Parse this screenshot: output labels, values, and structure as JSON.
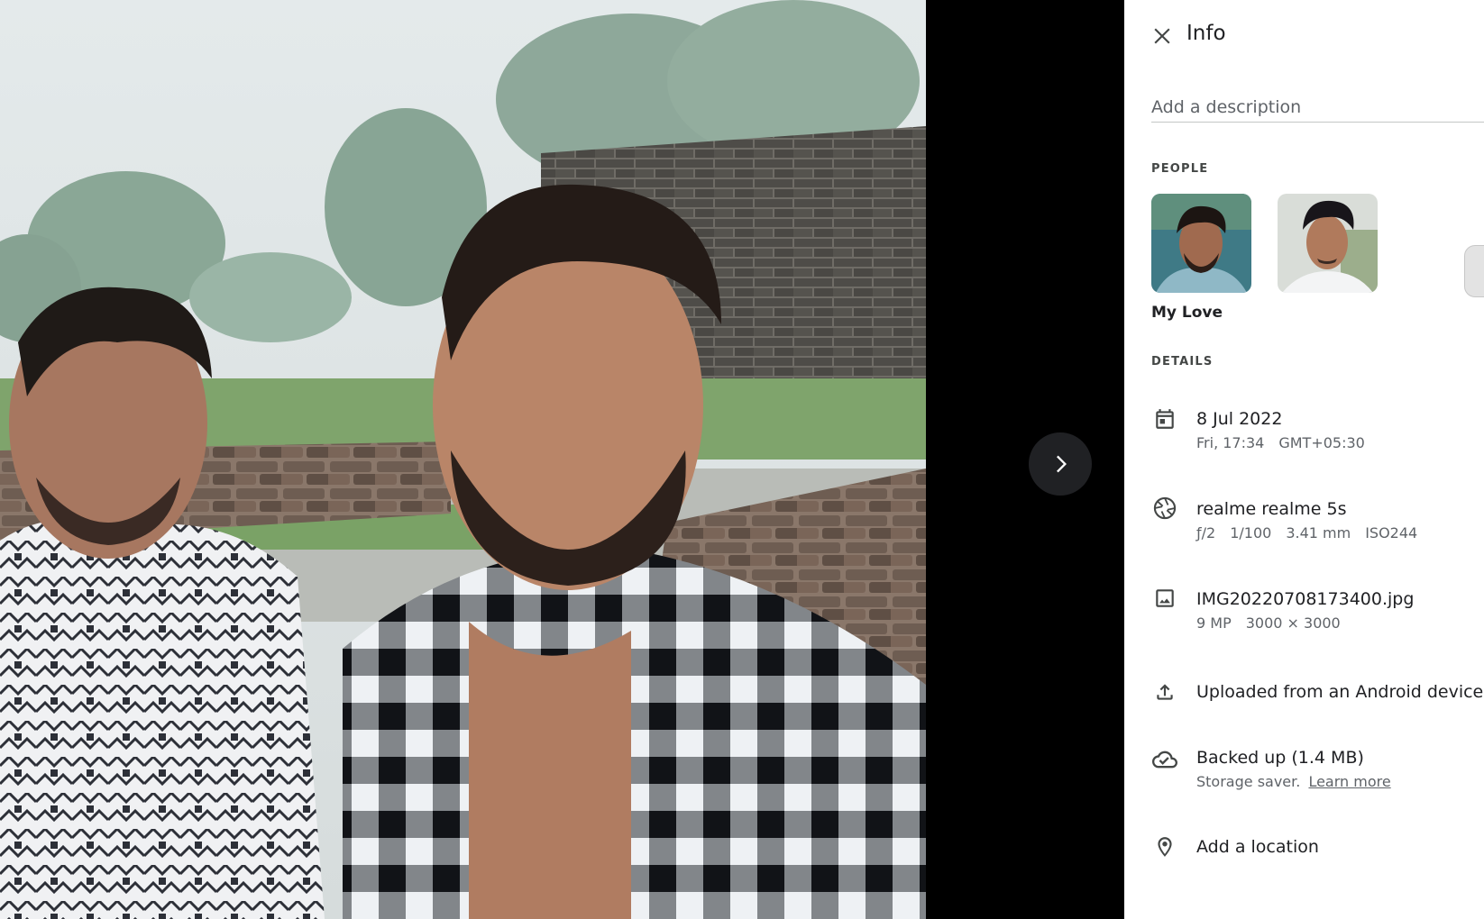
{
  "panel": {
    "title": "Info",
    "description_placeholder": "Add a description",
    "people_label": "PEOPLE",
    "people": [
      {
        "name": "My Love"
      },
      {
        "name": ""
      }
    ],
    "details_label": "DETAILS",
    "date": {
      "primary": "8 Jul 2022",
      "day_time": "Fri, 17:34",
      "timezone": "GMT+05:30",
      "icon": "calendar-icon"
    },
    "camera": {
      "primary": "realme realme 5s",
      "aperture": "ƒ/2",
      "shutter": "1/100",
      "focal": "3.41 mm",
      "iso": "ISO244",
      "icon": "aperture-icon"
    },
    "file": {
      "primary": "IMG20220708173400.jpg",
      "megapixels": "9 MP",
      "dimensions": "3000 × 3000",
      "icon": "image-icon"
    },
    "upload": {
      "primary": "Uploaded from an Android device",
      "icon": "upload-icon"
    },
    "backup": {
      "primary": "Backed up (1.4 MB)",
      "storage": "Storage saver.",
      "learn_more": "Learn more",
      "icon": "cloud-done-icon"
    },
    "location": {
      "primary": "Add a location",
      "icon": "location-pin-icon"
    }
  },
  "colors": {
    "link_blue": "#1a73e8",
    "panel_bg": "#ffffff",
    "viewer_bg": "#000000"
  }
}
